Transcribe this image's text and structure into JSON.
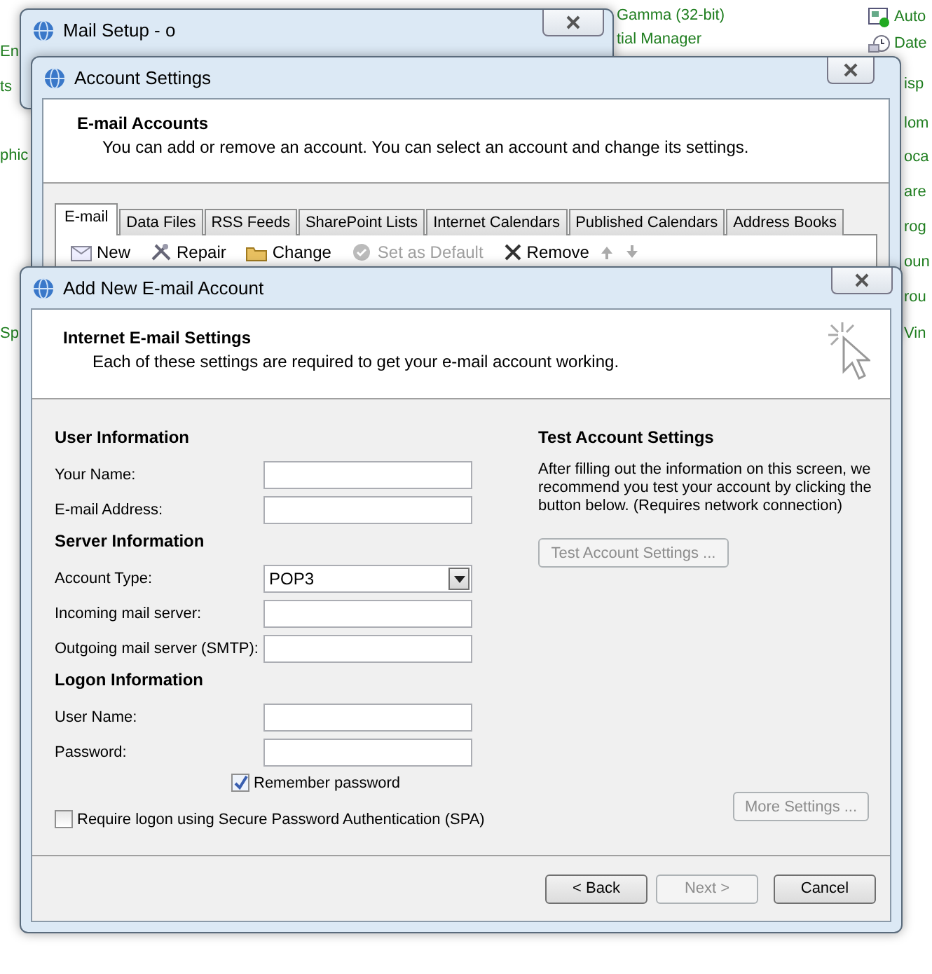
{
  "desktop": {
    "left_items": [
      "En",
      "ts",
      "phic",
      "Sp"
    ],
    "middle_items": [
      "Gamma (32-bit)",
      "tial Manager"
    ],
    "right_items": [
      "Auto",
      "Date",
      "isp",
      "lom",
      "oca",
      "are",
      "rog",
      "oun",
      "rou",
      "Vin"
    ]
  },
  "mail_setup": {
    "title": "Mail Setup - o"
  },
  "account_settings": {
    "title": "Account Settings",
    "heading": "E-mail Accounts",
    "description": "You can add or remove an account. You can select an account and change its settings.",
    "tabs": [
      {
        "label": "E-mail",
        "selected": true
      },
      {
        "label": "Data Files",
        "selected": false
      },
      {
        "label": "RSS Feeds",
        "selected": false
      },
      {
        "label": "SharePoint Lists",
        "selected": false
      },
      {
        "label": "Internet Calendars",
        "selected": false
      },
      {
        "label": "Published Calendars",
        "selected": false
      },
      {
        "label": "Address Books",
        "selected": false
      }
    ],
    "toolbar": [
      {
        "kind": "new",
        "label": "New",
        "disabled": false
      },
      {
        "kind": "repair",
        "label": "Repair",
        "disabled": false
      },
      {
        "kind": "change",
        "label": "Change",
        "disabled": false
      },
      {
        "kind": "default",
        "label": "Set as Default",
        "disabled": true
      },
      {
        "kind": "remove",
        "label": "Remove",
        "disabled": false
      },
      {
        "kind": "up",
        "disabled": true
      },
      {
        "kind": "down",
        "disabled": true
      }
    ]
  },
  "add_account": {
    "title": "Add New E-mail Account",
    "heading": "Internet E-mail Settings",
    "description": "Each of these settings are required to get your e-mail account working.",
    "sections": [
      {
        "heading": "User Information",
        "fields": [
          {
            "kind": "text",
            "label": "Your Name:"
          },
          {
            "kind": "text",
            "label": "E-mail Address:"
          }
        ]
      },
      {
        "heading": "Server Information",
        "fields": [
          {
            "kind": "dropdown",
            "label": "Account Type:",
            "value": "POP3"
          },
          {
            "kind": "text",
            "label": "Incoming mail server:"
          },
          {
            "kind": "text",
            "label": "Outgoing mail server (SMTP):"
          }
        ]
      },
      {
        "heading": "Logon Information",
        "fields": [
          {
            "kind": "text",
            "label": "User Name:"
          },
          {
            "kind": "text",
            "label": "Password:"
          }
        ]
      }
    ],
    "remember_password": {
      "label": "Remember password",
      "checked": true
    },
    "spa": {
      "label": "Require logon using Secure Password Authentication (SPA)",
      "checked": false
    },
    "test": {
      "heading": "Test Account Settings",
      "description": "After filling out the information on this screen, we recommend you test your account by clicking the button below. (Requires network connection)",
      "button": {
        "label": "Test Account Settings ...",
        "disabled": true
      }
    },
    "more_settings": {
      "label": "More Settings ...",
      "disabled": true
    },
    "buttons": [
      {
        "label": "< Back",
        "disabled": false
      },
      {
        "label": "Next >",
        "disabled": true
      },
      {
        "label": "Cancel",
        "disabled": false
      }
    ]
  }
}
